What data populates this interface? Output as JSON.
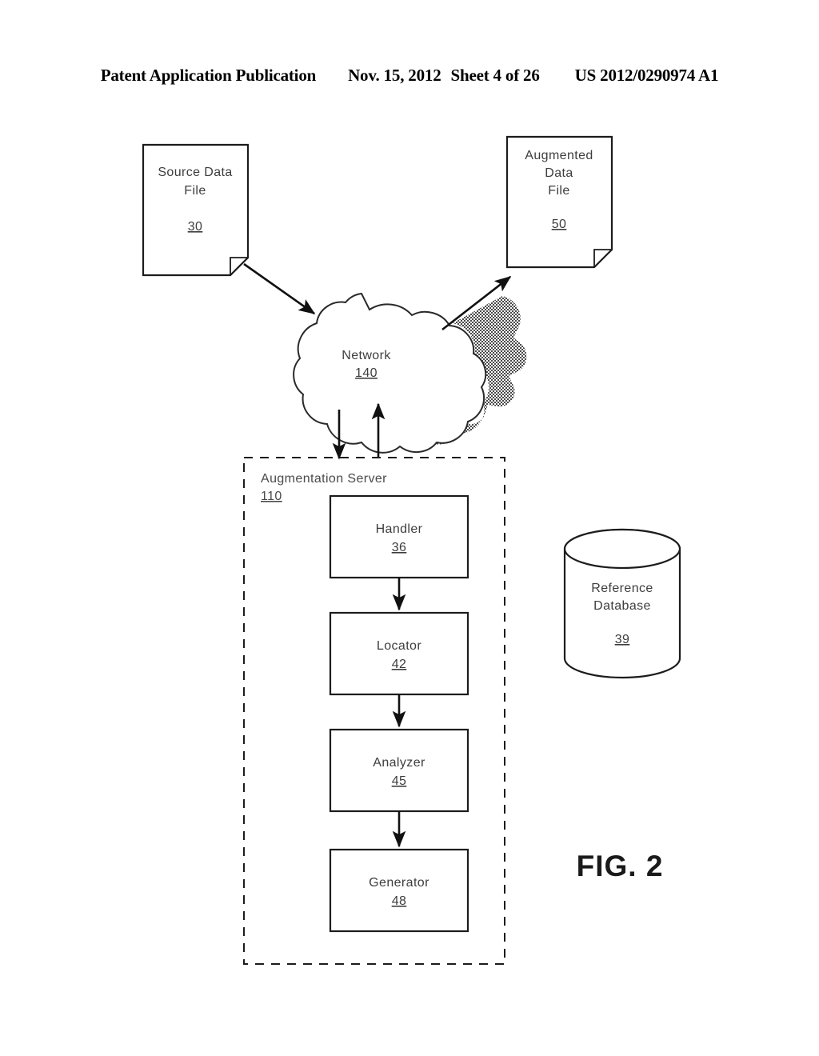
{
  "header": {
    "publication": "Patent Application Publication",
    "date": "Nov. 15, 2012",
    "sheet": "Sheet 4 of 26",
    "number": "US 2012/0290974 A1"
  },
  "figure": {
    "caption": "FIG. 2",
    "accent_color": "#1c1c1c"
  },
  "nodes": {
    "source_data_file": {
      "line1": "Source Data",
      "line2": "File",
      "ref": "30",
      "shape": "document"
    },
    "augmented_data_file": {
      "line1": "Augmented",
      "line2": "Data",
      "line3": "File",
      "ref": "50",
      "shape": "document"
    },
    "network": {
      "label": "Network",
      "ref": "140",
      "shape": "cloud"
    },
    "augmentation_server": {
      "label": "Augmentation Server",
      "ref": "110",
      "shape": "dashed-box"
    },
    "handler": {
      "label": "Handler",
      "ref": "36",
      "shape": "box"
    },
    "locator": {
      "label": "Locator",
      "ref": "42",
      "shape": "box"
    },
    "analyzer": {
      "label": "Analyzer",
      "ref": "45",
      "shape": "box"
    },
    "generator": {
      "label": "Generator",
      "ref": "48",
      "shape": "box"
    },
    "reference_database": {
      "line1": "Reference",
      "line2": "Database",
      "ref": "39",
      "shape": "cylinder"
    }
  },
  "connections": [
    {
      "from": "source_data_file",
      "to": "network",
      "style": "arrow"
    },
    {
      "from": "network",
      "to": "augmented_data_file",
      "style": "arrow"
    },
    {
      "from": "network",
      "to": "augmentation_server",
      "style": "arrow"
    },
    {
      "from": "augmentation_server",
      "to": "network",
      "style": "arrow"
    },
    {
      "from": "handler",
      "to": "locator",
      "style": "arrow"
    },
    {
      "from": "locator",
      "to": "analyzer",
      "style": "arrow"
    },
    {
      "from": "analyzer",
      "to": "generator",
      "style": "arrow"
    }
  ]
}
